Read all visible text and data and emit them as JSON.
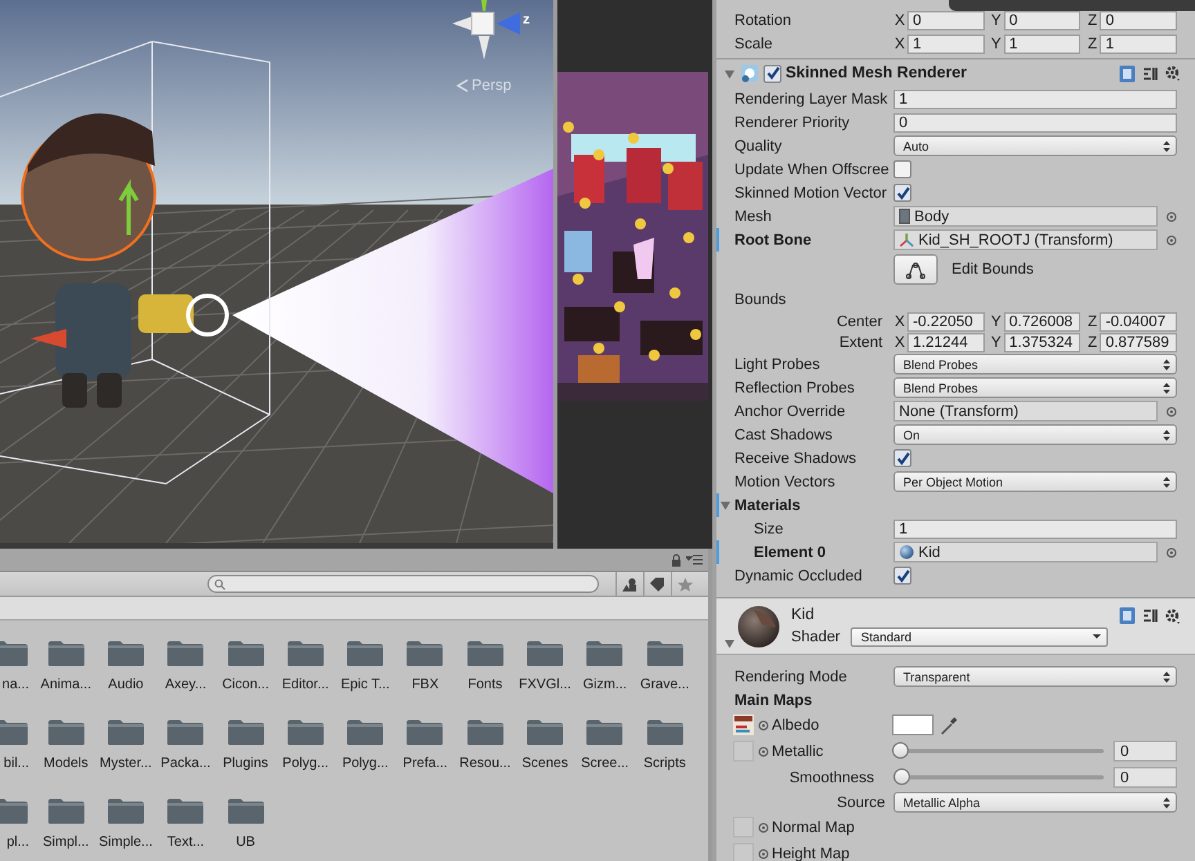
{
  "scene_view": {
    "axis_label": "z",
    "projection_label": "Persp"
  },
  "project": {
    "folders": [
      [
        "na...",
        "Anima...",
        "Audio",
        "Axey...",
        "Cicon...",
        "Editor...",
        "Epic T...",
        "FBX",
        "Fonts",
        "FXVGl...",
        "Gizm...",
        "Grave..."
      ],
      [
        "bil...",
        "Models",
        "Myster...",
        "Packa...",
        "Plugins",
        "Polyg...",
        "Polyg...",
        "Prefa...",
        "Resou...",
        "Scenes",
        "Scree...",
        "Scripts"
      ],
      [
        "pl...",
        "Simpl...",
        "Simple...",
        "Text...",
        "UB"
      ]
    ]
  },
  "inspector": {
    "transform": {
      "rows": [
        {
          "label": "Rotation",
          "values": [
            {
              "axis": "X",
              "value": "0"
            },
            {
              "axis": "Y",
              "value": "0"
            },
            {
              "axis": "Z",
              "value": "0"
            }
          ]
        },
        {
          "label": "Scale",
          "values": [
            {
              "axis": "X",
              "value": "1"
            },
            {
              "axis": "Y",
              "value": "1"
            },
            {
              "axis": "Z",
              "value": "1"
            }
          ]
        }
      ]
    },
    "component": {
      "title": "Skinned Mesh Renderer",
      "enabled": true,
      "expanded": true,
      "properties": [
        {
          "kind": "text",
          "label": "Rendering Layer Mask",
          "value": "1"
        },
        {
          "kind": "text",
          "label": "Renderer Priority",
          "value": "0"
        },
        {
          "kind": "dropdown",
          "label": "Quality",
          "value": "Auto"
        },
        {
          "kind": "checkbox",
          "label": "Update When Offscree",
          "checked": false
        },
        {
          "kind": "checkbox",
          "label": "Skinned Motion Vector",
          "checked": true
        },
        {
          "kind": "mesh",
          "label": "Mesh",
          "value": "Body",
          "modified": false
        },
        {
          "kind": "bone",
          "label": "Root Bone",
          "value": "Kid_SH_ROOTJ (Transform)",
          "modified": true
        },
        {
          "kind": "button",
          "value": "Edit Bounds"
        },
        {
          "kind": "header",
          "label": "Bounds",
          "children": [
            {
              "kind": "vector",
              "label": "Center",
              "values": [
                {
                  "axis": "X",
                  "value": "-0.22050"
                },
                {
                  "axis": "Y",
                  "value": "0.726008"
                },
                {
                  "axis": "Z",
                  "value": "-0.04007"
                }
              ]
            },
            {
              "kind": "vector",
              "label": "Extent",
              "values": [
                {
                  "axis": "X",
                  "value": "1.21244"
                },
                {
                  "axis": "Y",
                  "value": "1.375324"
                },
                {
                  "axis": "Z",
                  "value": "0.877589"
                }
              ]
            }
          ]
        },
        {
          "kind": "dropdown",
          "label": "Light Probes",
          "value": "Blend Probes"
        },
        {
          "kind": "dropdown",
          "label": "Reflection Probes",
          "value": "Blend Probes"
        },
        {
          "kind": "object",
          "label": "Anchor Override",
          "value": "None (Transform)",
          "modified": false
        },
        {
          "kind": "dropdown",
          "label": "Cast Shadows",
          "value": "On"
        },
        {
          "kind": "checkbox",
          "label": "Receive Shadows",
          "checked": true
        },
        {
          "kind": "dropdown",
          "label": "Motion Vectors",
          "value": "Per Object Motion"
        },
        {
          "kind": "foldout",
          "label": "Materials",
          "expanded": true,
          "modified": true,
          "children": [
            {
              "kind": "text",
              "label": "Size",
              "value": "1"
            },
            {
              "kind": "material",
              "label": "Element 0",
              "value": "Kid",
              "modified": true
            }
          ]
        },
        {
          "kind": "checkbox",
          "label": "Dynamic Occluded",
          "checked": true
        }
      ]
    },
    "material": {
      "name": "Kid",
      "shader_label": "Shader",
      "shader": "Standard",
      "expanded": true,
      "properties": [
        {
          "kind": "dropdown",
          "label": "Rendering Mode",
          "value": "Transparent"
        },
        {
          "kind": "header",
          "label": "Main Maps"
        },
        {
          "kind": "map",
          "label": "Albedo",
          "has_texture": true,
          "color": "#ffffff"
        },
        {
          "kind": "map",
          "label": "Metallic",
          "has_texture": false,
          "level": 0,
          "value": "0",
          "children": [
            {
              "kind": "slider",
              "label": "Smoothness",
              "level": 0,
              "value": "0",
              "children": [
                {
                  "kind": "dropdown",
                  "label": "Source",
                  "value": "Metallic Alpha"
                }
              ]
            }
          ]
        },
        {
          "kind": "map",
          "label": "Normal Map",
          "has_texture": false
        },
        {
          "kind": "map",
          "label": "Height Map",
          "has_texture": false
        }
      ]
    }
  }
}
